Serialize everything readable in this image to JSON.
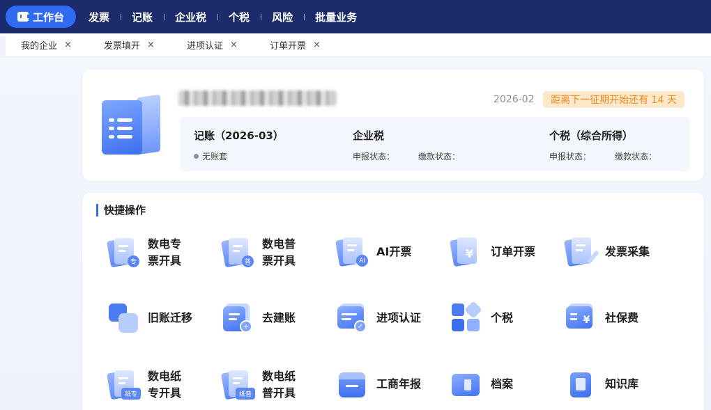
{
  "topnav": {
    "workbench_label": "工作台",
    "items": [
      "发票",
      "记账",
      "企业税",
      "个税",
      "风险",
      "批量业务"
    ]
  },
  "tabs": [
    {
      "label": "我的企业"
    },
    {
      "label": "发票填开"
    },
    {
      "label": "进项认证"
    },
    {
      "label": "订单开票"
    }
  ],
  "tab_close_glyph": "×",
  "company": {
    "period": "2026-02",
    "next_period_notice": "距离下一征期开始还有 14 天",
    "bookkeeping": {
      "title": "记账（2026-03）",
      "status": "无账套"
    },
    "corporate_tax": {
      "title": "企业税",
      "declare_label": "申报状态：",
      "payment_label": "缴款状态："
    },
    "personal_tax": {
      "title": "个税（综合所得）",
      "declare_label": "申报状态：",
      "payment_label": "缴款状态："
    }
  },
  "quick_actions": {
    "title": "快捷操作",
    "items": [
      {
        "label_line1": "数电专",
        "label_line2": "票开具",
        "icon": "digital-special-invoice-icon",
        "badge": "专"
      },
      {
        "label_line1": "数电普",
        "label_line2": "票开具",
        "icon": "digital-general-invoice-icon",
        "badge": "普"
      },
      {
        "label_line1": "AI开票",
        "label_line2": "",
        "icon": "ai-invoice-icon",
        "badge": "AI"
      },
      {
        "label_line1": "订单开票",
        "label_line2": "",
        "icon": "order-invoice-icon",
        "badge": "¥"
      },
      {
        "label_line1": "发票采集",
        "label_line2": "",
        "icon": "invoice-collect-icon",
        "badge": ""
      },
      {
        "label_line1": "旧账迁移",
        "label_line2": "",
        "icon": "old-account-migrate-icon",
        "badge": ""
      },
      {
        "label_line1": "去建账",
        "label_line2": "",
        "icon": "create-account-icon",
        "badge": "+"
      },
      {
        "label_line1": "进项认证",
        "label_line2": "",
        "icon": "input-certification-icon",
        "badge": "✓"
      },
      {
        "label_line1": "个税",
        "label_line2": "",
        "icon": "personal-tax-icon",
        "badge": ""
      },
      {
        "label_line1": "社保费",
        "label_line2": "",
        "icon": "social-security-icon",
        "badge": "¥"
      },
      {
        "label_line1": "数电纸",
        "label_line2": "专开具",
        "icon": "paper-special-invoice-icon",
        "badge": "纸专"
      },
      {
        "label_line1": "数电纸",
        "label_line2": "普开具",
        "icon": "paper-general-invoice-icon",
        "badge": "纸普"
      },
      {
        "label_line1": "工商年报",
        "label_line2": "",
        "icon": "annual-report-icon",
        "badge": ""
      },
      {
        "label_line1": "档案",
        "label_line2": "",
        "icon": "archive-icon",
        "badge": ""
      },
      {
        "label_line1": "知识库",
        "label_line2": "",
        "icon": "knowledge-base-icon",
        "badge": ""
      }
    ]
  },
  "colors": {
    "nav_bg": "#1b2b6b",
    "accent": "#2f6cf2",
    "notice_bg": "#fde8cc",
    "notice_text": "#f08a1c"
  }
}
